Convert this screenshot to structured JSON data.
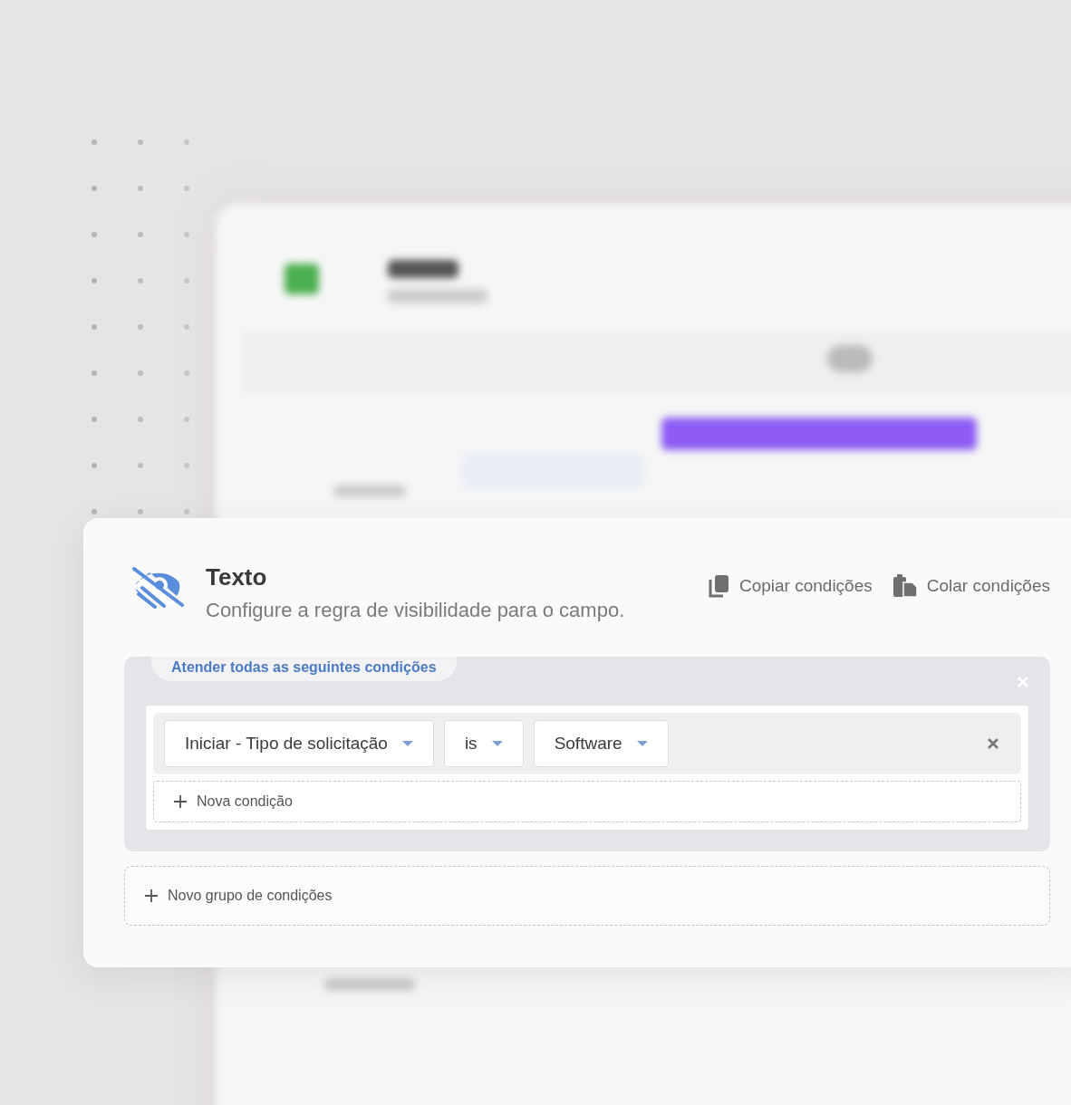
{
  "panel": {
    "title": "Texto",
    "subtitle": "Configure a regra de visibilidade para o campo.",
    "actions": [
      {
        "label": "Copiar condições",
        "kind": "copy"
      },
      {
        "label": "Colar condições",
        "kind": "paste"
      }
    ]
  },
  "groups": [
    {
      "match_label": "Atender todas as seguintes condições",
      "conditions": [
        {
          "field": "Iniciar - Tipo de solicitação",
          "operator": "is",
          "value": "Software"
        }
      ],
      "add_condition": "Nova condição"
    }
  ],
  "add_group": "Novo grupo de condições"
}
